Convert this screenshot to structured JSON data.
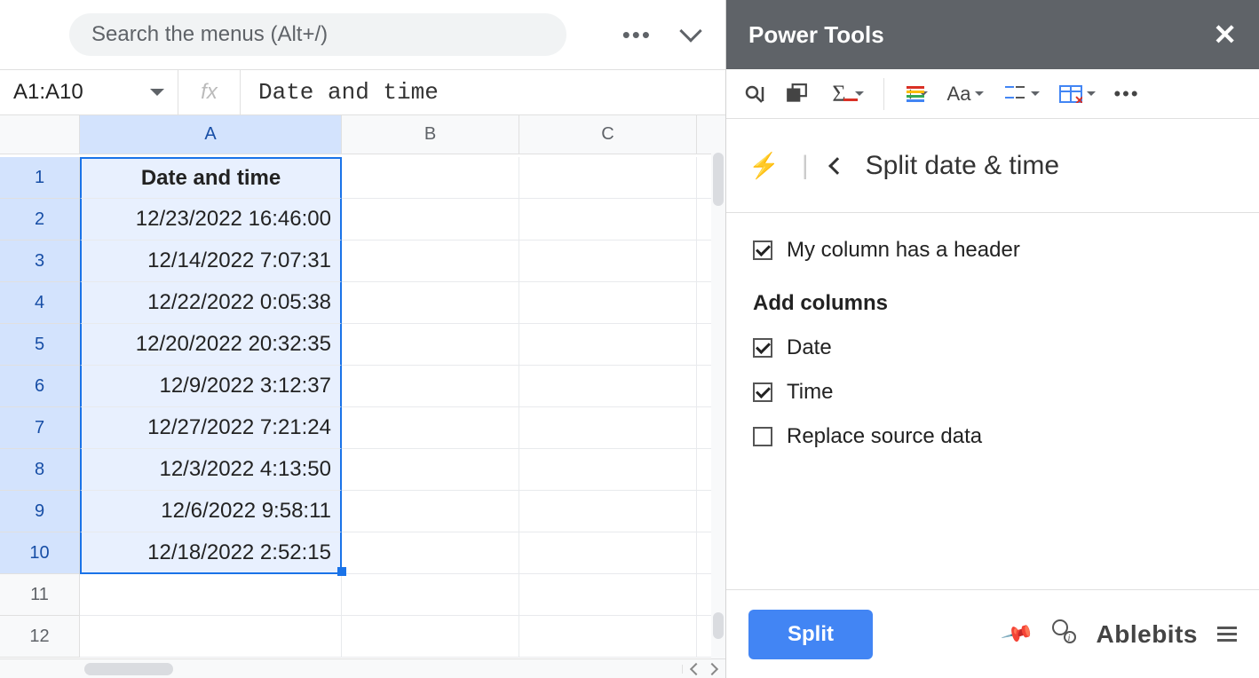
{
  "search": {
    "placeholder": "Search the menus (Alt+/)"
  },
  "name_box": "A1:A10",
  "formula_bar": "Date and time",
  "columns": [
    "A",
    "B",
    "C"
  ],
  "row_count": 12,
  "selected_col_index": 0,
  "selected_rows": [
    1,
    2,
    3,
    4,
    5,
    6,
    7,
    8,
    9,
    10
  ],
  "cells": {
    "A1": "Date and time",
    "A2": "12/23/2022 16:46:00",
    "A3": "12/14/2022 7:07:31",
    "A4": "12/22/2022 0:05:38",
    "A5": "12/20/2022 20:32:35",
    "A6": "12/9/2022 3:12:37",
    "A7": "12/27/2022 7:21:24",
    "A8": "12/3/2022 4:13:50",
    "A9": "12/6/2022 9:58:11",
    "A10": "12/18/2022 2:52:15"
  },
  "panel": {
    "title": "Power Tools",
    "breadcrumb": "Split date & time",
    "checkbox_header": "My column has a header",
    "section": "Add columns",
    "checkbox_date": "Date",
    "checkbox_time": "Time",
    "checkbox_replace": "Replace source data",
    "button": "Split",
    "brand": "Ablebits"
  }
}
